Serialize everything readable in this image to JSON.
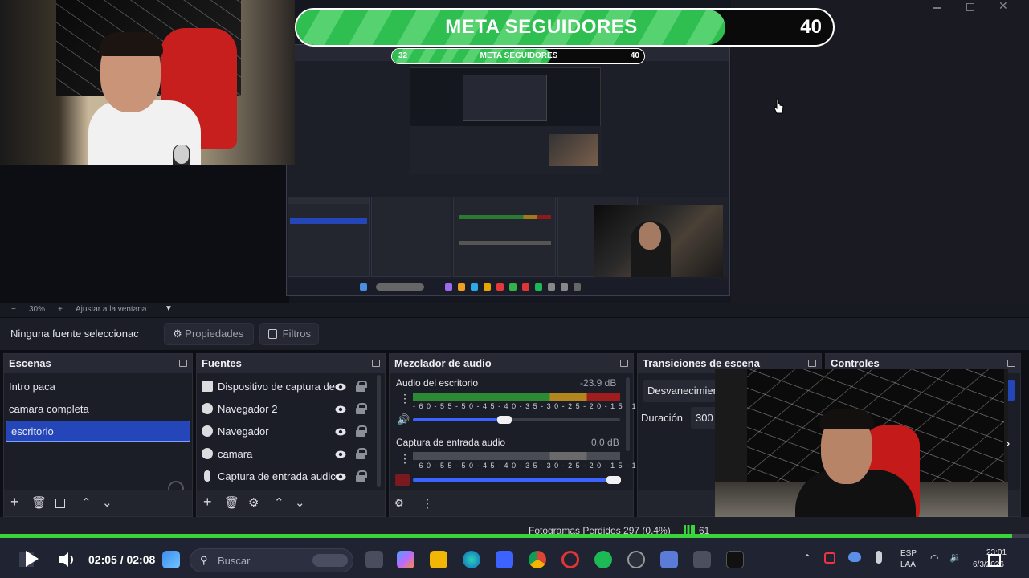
{
  "overlay": {
    "goal_title": "META SEGUIDORES",
    "goal_target": "40",
    "goal_current": "32",
    "goal_progress": 0.8
  },
  "preview": {
    "zoom_minus": "−",
    "zoom_value": "30%",
    "zoom_plus": "+",
    "zoom_fit": "Ajustar a la ventana"
  },
  "source_toolbar": {
    "no_source": "Ninguna fuente seleccionac",
    "properties": "Propiedades",
    "filters": "Filtros"
  },
  "scenes": {
    "title": "Escenas",
    "items": [
      "Intro paca",
      "camara completa",
      "escritorio"
    ],
    "selected_index": 2
  },
  "sources": {
    "title": "Fuentes",
    "items": [
      {
        "label": "Dispositivo de captura de",
        "icon": "camera-icon"
      },
      {
        "label": "Navegador 2",
        "icon": "globe-icon"
      },
      {
        "label": "Navegador",
        "icon": "globe-icon"
      },
      {
        "label": "camara",
        "icon": "globe-icon"
      },
      {
        "label": "Captura de entrada audic",
        "icon": "microphone-icon"
      }
    ]
  },
  "mixer": {
    "title": "Mezclador de audio",
    "channels": [
      {
        "name": "Audio del escritorio",
        "level": "-23.9 dB",
        "volume": 0.44,
        "muted": false
      },
      {
        "name": "Captura de entrada audio",
        "level": "0.0 dB",
        "volume": 0.97,
        "muted": true
      }
    ],
    "scale": [
      "-60",
      "-55",
      "-50",
      "-45",
      "-40",
      "-35",
      "-30",
      "-25",
      "-20",
      "-15",
      "-10",
      "-5",
      "0"
    ]
  },
  "transitions": {
    "title": "Transiciones de escena",
    "current": "Desvanecimien",
    "duration_label": "Duración",
    "duration_value": "300"
  },
  "controls": {
    "title": "Controles"
  },
  "status": {
    "dropped_frames": "Fotogramas Perdidos 297 (0.4%)",
    "bitrate": "61"
  },
  "player": {
    "time": "02:05 / 02:08"
  },
  "taskbar": {
    "search_placeholder": "Buscar",
    "lang_top": "ESP",
    "lang_bottom": "LAA",
    "clock_time": "23:01",
    "clock_date": "6/3/2026"
  },
  "colors": {
    "accent_blue": "#2446b8",
    "goal_green": "#2fbf51",
    "progress_green": "#3ad53a"
  }
}
